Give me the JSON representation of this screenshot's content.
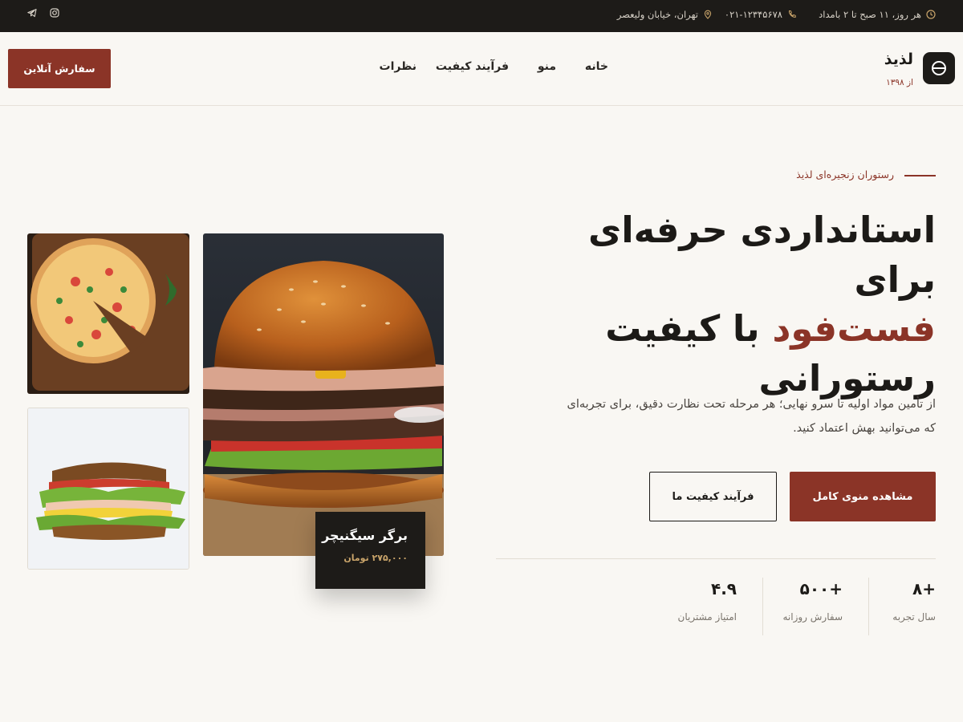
{
  "topbar": {
    "hours": "هر روز، ۱۱ صبح تا ۲ بامداد",
    "phone": "۰۲۱-۱۲۳۴۵۶۷۸",
    "address": "تهران، خیابان ولیعصر",
    "icons": [
      "clock-icon",
      "phone-icon",
      "location-pin-icon",
      "instagram-icon",
      "telegram-icon"
    ]
  },
  "brand": {
    "name": "لذیذ",
    "since": "از ۱۳۹۸"
  },
  "nav": {
    "items": [
      {
        "label": "خانه"
      },
      {
        "label": "منو"
      },
      {
        "label": "فرآیند کیفیت"
      },
      {
        "label": "نظرات"
      }
    ],
    "order_button": "سفارش آنلاین"
  },
  "hero": {
    "eyebrow": "رستوران زنجیره‌ای لذیذ",
    "title_line1": "استانداردی حرفه‌ای برای",
    "title_accent": "فست‌فود",
    "title_line2_rest": " با کیفیت",
    "title_line3": "رستورانی",
    "description": "از تأمین مواد اولیه تا سرو نهایی؛ هر مرحله تحت نظارت دقیق، برای تجربه‌ای که می‌توانید بهش اعتماد کنید.",
    "primary_button": "مشاهده منوی کامل",
    "secondary_button": "فرآیند کیفیت ما"
  },
  "stats": [
    {
      "value": "+۸",
      "label": "سال تجربه"
    },
    {
      "value": "+۵۰۰",
      "label": "سفارش روزانه"
    },
    {
      "value": "۴.۹",
      "label": "امتیاز مشتریان"
    }
  ],
  "featured": {
    "name": "برگر سیگنیچر",
    "price": "۲۷۵,۰۰۰ تومان"
  },
  "colors": {
    "accent": "#8b3427",
    "dark": "#1d1b18",
    "background": "#f9f7f3",
    "gold": "#c9a46a"
  }
}
